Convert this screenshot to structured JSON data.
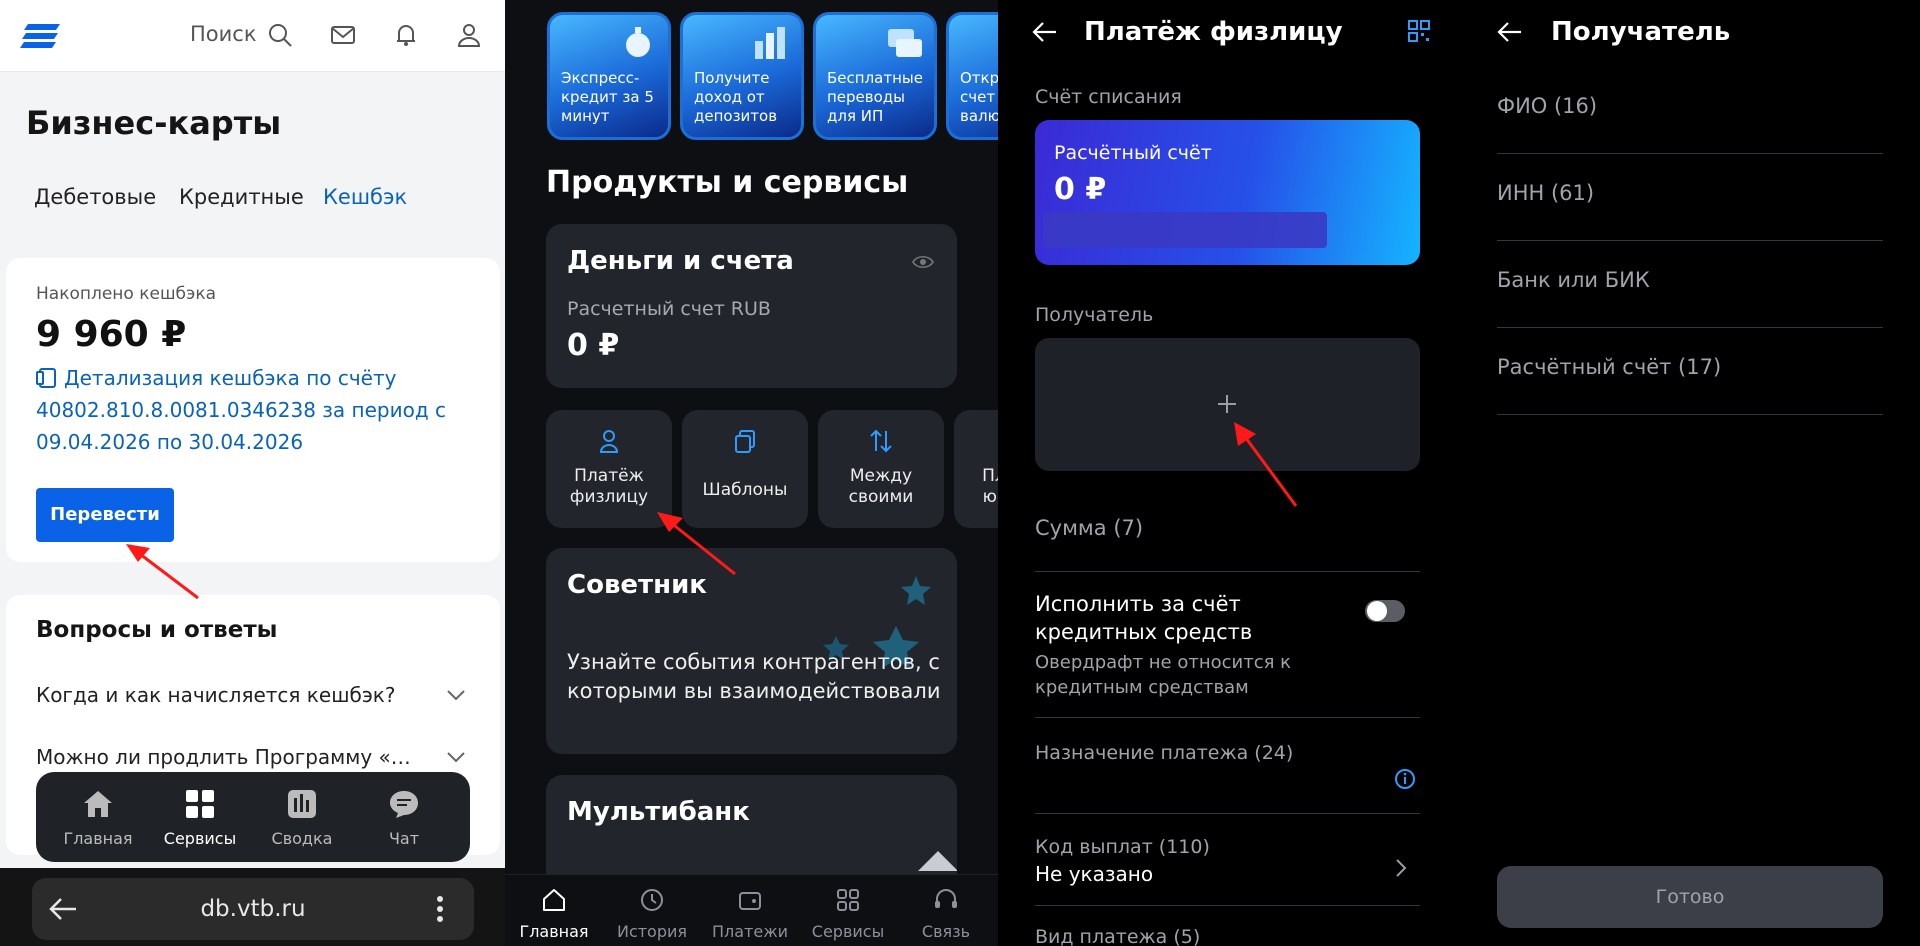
{
  "panel1": {
    "search_label": "Поиск",
    "page_title": "Бизнес-карты",
    "tabs": [
      {
        "label": "Дебетовые"
      },
      {
        "label": "Кредитные"
      },
      {
        "label": "Кешбэк"
      }
    ],
    "cashback_card": {
      "accumulated_label": "Накоплено кешбэка",
      "amount": "9 960 ₽",
      "detail_link": "Детализация кешбэка по счёту 40802.810.8.0081.0346238 за период с 09.04.2026 по 30.04.2026",
      "transfer_button": "Перевести"
    },
    "faq": {
      "title": "Вопросы и ответы",
      "items": [
        {
          "question": "Когда и как начисляется кешбэк?"
        },
        {
          "question": "Можно ли продлить Программу «…"
        }
      ]
    },
    "bottom_nav": [
      {
        "label": "Главная",
        "icon": "home-icon"
      },
      {
        "label": "Сервисы",
        "icon": "grid-icon"
      },
      {
        "label": "Сводка",
        "icon": "chart-icon"
      },
      {
        "label": "Чат",
        "icon": "chat-icon"
      }
    ],
    "url": "db.vtb.ru"
  },
  "panel2": {
    "promos": [
      {
        "text": "Экспресс-кредит за 5 минут"
      },
      {
        "text": "Получите доход от депозитов"
      },
      {
        "text": "Бесплатные переводы для ИП"
      },
      {
        "text": "Открыть счет в валюте"
      }
    ],
    "section_title": "Продукты и сервисы",
    "money_card": {
      "title": "Деньги и счета",
      "account_label": "Расчетный счет RUB",
      "balance": "0 ₽"
    },
    "quick_actions": [
      {
        "label": "Платёж физлицу",
        "icon": "person-icon"
      },
      {
        "label": "Шаблоны",
        "icon": "copy-icon"
      },
      {
        "label": "Между своими",
        "icon": "swap-icon"
      },
      {
        "label": "Платёж юрлицу",
        "icon": "building-icon"
      }
    ],
    "advisor": {
      "title": "Советник",
      "text": "Узнайте события контрагентов, с которыми вы взаимодействовали"
    },
    "multibank": {
      "title": "Мультибанк"
    },
    "tabbar": [
      {
        "label": "Главная",
        "icon": "home-icon"
      },
      {
        "label": "История",
        "icon": "clock-icon"
      },
      {
        "label": "Платежи",
        "icon": "wallet-icon"
      },
      {
        "label": "Сервисы",
        "icon": "grid-icon"
      },
      {
        "label": "Связь",
        "icon": "headset-icon"
      }
    ]
  },
  "panel3": {
    "title": "Платёж физлицу",
    "debit_label": "Счёт списания",
    "account_name": "Расчётный счёт",
    "account_amount": "0 ₽",
    "recipient_label": "Получатель",
    "amount_label": "Сумма (7)",
    "credit_toggle_title": "Исполнить за счёт кредитных средств",
    "credit_toggle_subtitle": "Овердрафт не относится к кредитным средствам",
    "purpose_label": "Назначение платежа (24)",
    "payout_code_label": "Код выплат (110)",
    "payout_code_value": "Не указано",
    "payment_type_label": "Вид платежа (5)"
  },
  "panel4": {
    "title": "Получатель",
    "fields": [
      {
        "label": "ФИО (16)"
      },
      {
        "label": "ИНН (61)"
      },
      {
        "label": "Банк или БИК"
      },
      {
        "label": "Расчётный счёт (17)"
      }
    ],
    "done_button": "Готово"
  },
  "colors": {
    "accent_blue": "#0a63e6",
    "link_blue": "#0a63b8",
    "annotation_red": "#ff1a1a"
  }
}
